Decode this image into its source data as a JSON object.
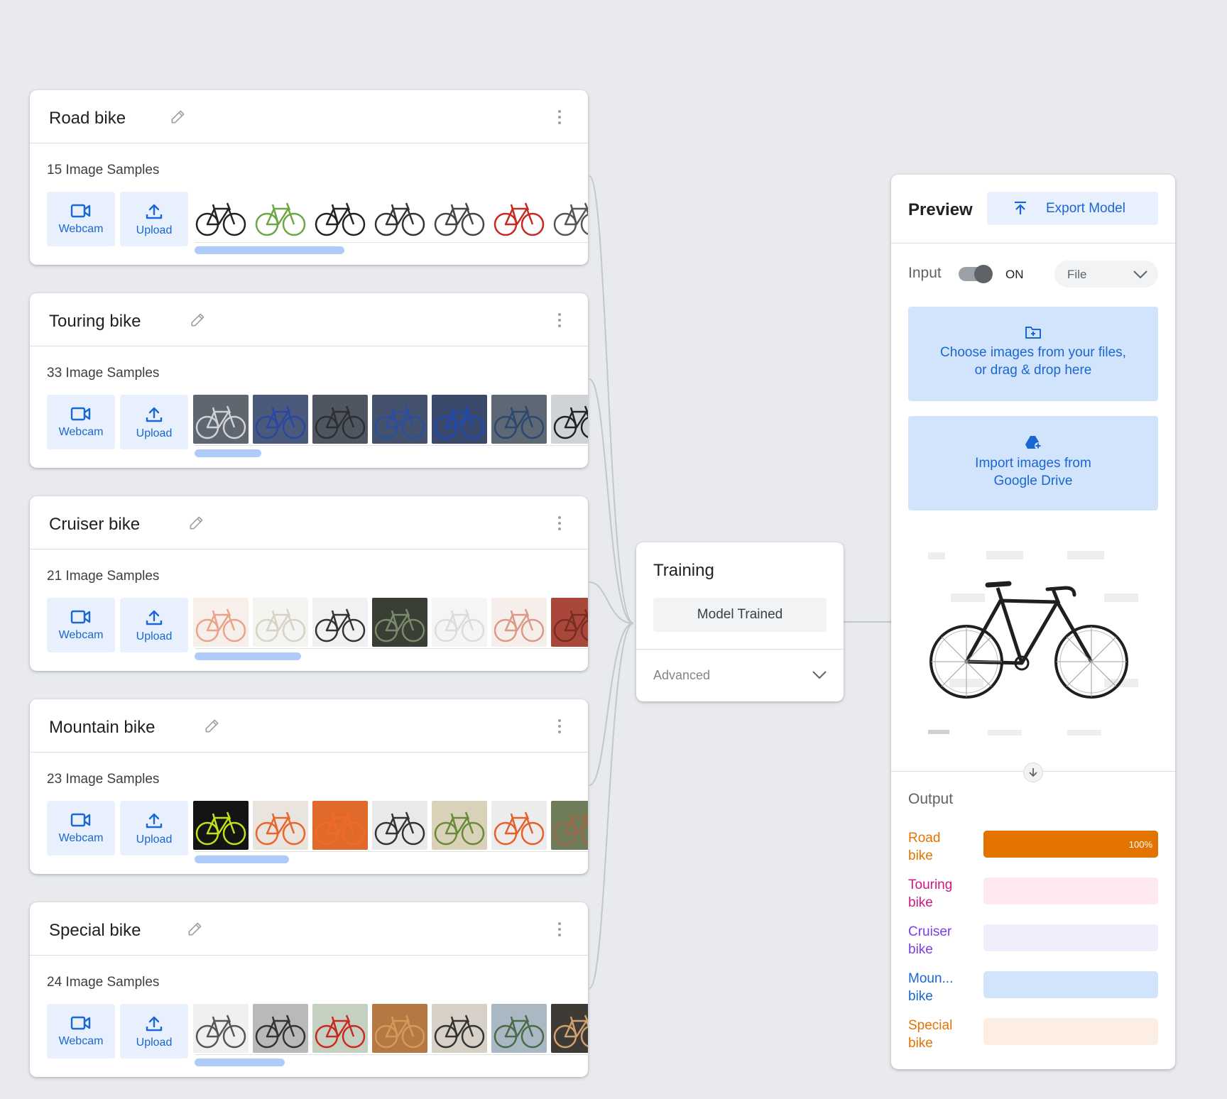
{
  "classes": [
    {
      "name": "Road bike",
      "samples": "15 Image Samples",
      "webcam": "Webcam",
      "upload": "Upload",
      "scroll": 0.38
    },
    {
      "name": "Touring bike",
      "samples": "33 Image Samples",
      "webcam": "Webcam",
      "upload": "Upload",
      "scroll": 0.17
    },
    {
      "name": "Cruiser bike",
      "samples": "21 Image Samples",
      "webcam": "Webcam",
      "upload": "Upload",
      "scroll": 0.27
    },
    {
      "name": "Mountain bike",
      "samples": "23 Image Samples",
      "webcam": "Webcam",
      "upload": "Upload",
      "scroll": 0.24
    },
    {
      "name": "Special bike",
      "samples": "24 Image Samples",
      "webcam": "Webcam",
      "upload": "Upload",
      "scroll": 0.23
    }
  ],
  "training": {
    "title": "Training",
    "button": "Model Trained",
    "advanced": "Advanced"
  },
  "preview": {
    "title": "Preview",
    "export": "Export Model",
    "input_label": "Input",
    "toggle_state": "ON",
    "source": "File",
    "drop_files": [
      "Choose images from your files,",
      "or drag & drop here"
    ],
    "drive": [
      "Import images from",
      "Google Drive"
    ],
    "output_label": "Output"
  },
  "outputs": [
    {
      "line1": "Road",
      "line2": "bike",
      "color": "#e37400",
      "track": "#e37400",
      "value": 1.0,
      "pct": "100%"
    },
    {
      "line1": "Touring",
      "line2": "bike",
      "color": "#d01884",
      "track": "#fde7f0",
      "value": 0,
      "pct": ""
    },
    {
      "line1": "Cruiser",
      "line2": "bike",
      "color": "#7b3fe4",
      "track": "#f0eefc",
      "value": 0,
      "pct": ""
    },
    {
      "line1": "Moun...",
      "line2": "bike",
      "color": "#1967d2",
      "track": "#d2e3fc",
      "value": 0,
      "pct": ""
    },
    {
      "line1": "Special",
      "line2": "bike",
      "color": "#e37400",
      "track": "#fdeee4",
      "value": 0,
      "pct": ""
    }
  ],
  "icons": {
    "edit": "pencil-icon",
    "menu": "more-vert-icon",
    "webcam": "videocam-icon",
    "upload": "upload-icon",
    "export": "export-icon",
    "file_add": "folder-add-icon",
    "drive": "drive-add-icon",
    "chevron": "chevron-down-icon",
    "arrow": "arrow-down-icon"
  }
}
